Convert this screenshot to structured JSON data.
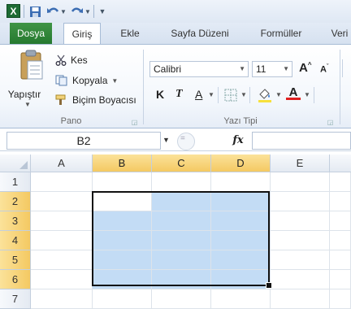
{
  "quick_access": {
    "app_icon": "excel-icon",
    "logo_letter": "X",
    "items": [
      "save-icon",
      "undo-icon",
      "redo-icon",
      "customize-icon"
    ]
  },
  "tabs": [
    "Dosya",
    "Giriş",
    "Ekle",
    "Sayfa Düzeni",
    "Formüller",
    "Veri"
  ],
  "ribbon": {
    "clipboard": {
      "paste_label": "Yapıştır",
      "cut_label": "Kes",
      "copy_label": "Kopyala",
      "painter_label": "Biçim Boyacısı",
      "group_label": "Pano"
    },
    "font": {
      "font_name": "Calibri",
      "font_size": "11",
      "bold": "K",
      "italic": "T",
      "underline": "A",
      "grow": "A",
      "shrink": "A",
      "group_label": "Yazı Tipi"
    }
  },
  "formula_bar": {
    "name_box": "B2",
    "fx": "fx",
    "value": ""
  },
  "sheet": {
    "columns": [
      "A",
      "B",
      "C",
      "D",
      "E"
    ],
    "rows": [
      "1",
      "2",
      "3",
      "4",
      "5",
      "6",
      "7"
    ],
    "selected_range": "B2:D6",
    "active_cell": "B2"
  },
  "colors": {
    "selection_fill": "#c3dcf5",
    "header_highlight": "#f4c962",
    "file_tab": "#2f8a3a"
  }
}
